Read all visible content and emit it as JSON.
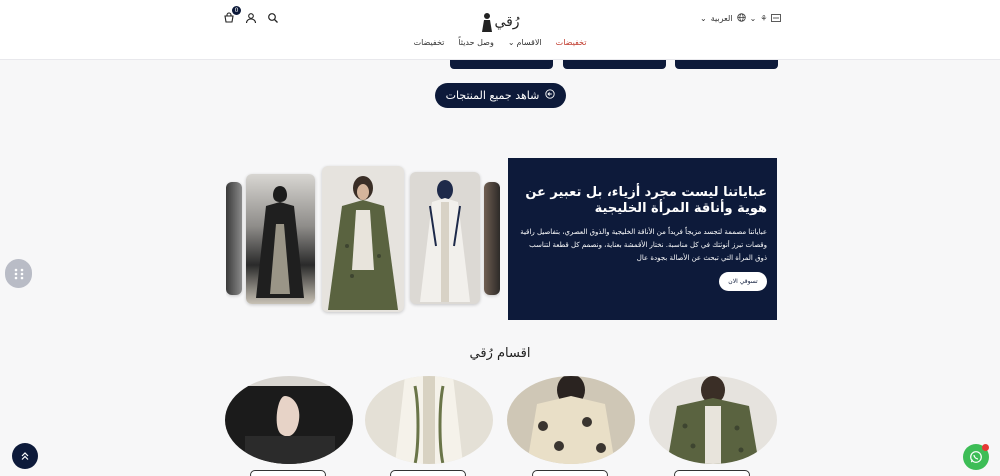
{
  "header": {
    "logo_text": "رُقي",
    "language": "العربية",
    "cart_count": "0",
    "nav": [
      {
        "label": "تخفيضات",
        "style": "sale"
      },
      {
        "label": "الاقسام",
        "has_dropdown": true
      },
      {
        "label": "وصل حديثاً"
      },
      {
        "label": "تخفيضات"
      }
    ]
  },
  "view_all_label": "شاهد جميع المنتجات",
  "promo": {
    "title": "عباياتنا ليست مجرد أزياء، بل تعبير عن هوية وأناقة المرأة الخليجية",
    "body": "عباياتنا مصممة لتجسد مزيجاً فريداً من الأناقة الخليجية والذوق العصري، بتفاصيل راقية وقصات تبرز أنوثتك في كل مناسبة. نختار الأقمشة بعناية، ونصمم كل قطعة لتناسب ذوق المرأة التي تبحث عن الأصالة بجودة عال",
    "button": "تسوقي الان"
  },
  "categories_title": "اقسام رُقي",
  "colors": {
    "navy": "#0d1a3a",
    "sale": "#c0392b",
    "whatsapp": "#3dbd56",
    "olive": "#55603c"
  }
}
